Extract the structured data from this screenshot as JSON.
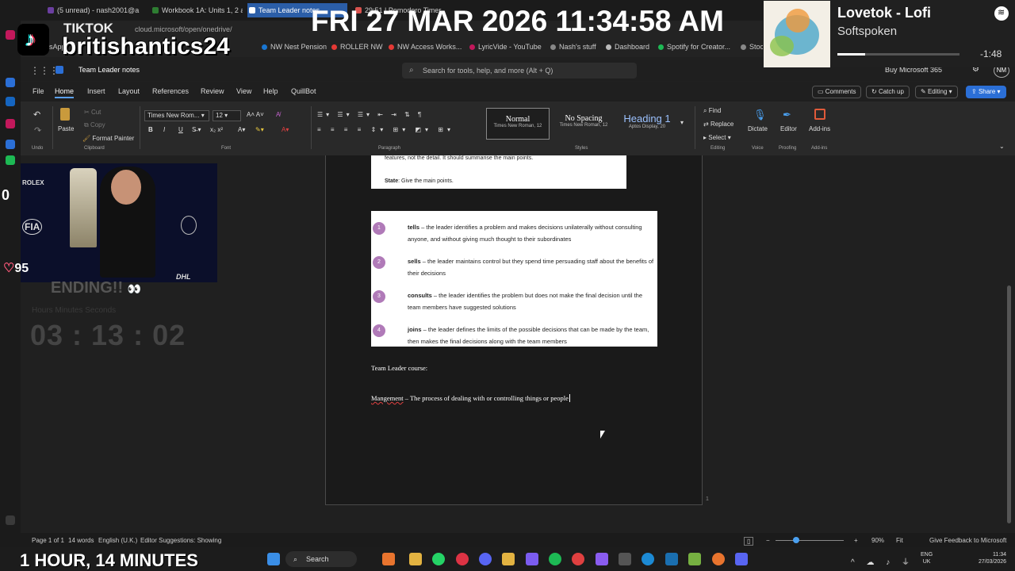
{
  "browser": {
    "tabs": [
      {
        "label": "(5 unread) - nash2001@a",
        "color": "#6b3fa0",
        "active": false
      },
      {
        "label": "Workbook 1A: Units 1, 2 a",
        "color": "#2e7d32",
        "active": false
      },
      {
        "label": "Team Leader notes",
        "color": "#2b5ea8",
        "active": true
      },
      {
        "label": "29:51 | Pomodoro Timer",
        "color": "#d9534f",
        "active": false
      }
    ],
    "url": "cloud.microsoft/open/onedrive/",
    "bookmarks": [
      {
        "label": "WhatsApp",
        "color": "#25d366"
      },
      {
        "label": "NW Nest Pension",
        "color": "#1976d2"
      },
      {
        "label": "ROLLER NW",
        "color": "#e53935"
      },
      {
        "label": "NW Access Works...",
        "color": "#e53935"
      },
      {
        "label": "LyricVide - YouTube",
        "color": "#c2185b"
      },
      {
        "label": "Nash's stuff",
        "color": "#888888"
      },
      {
        "label": "Dashboard",
        "color": "#bbbbbb"
      },
      {
        "label": "Spotify for Creator...",
        "color": "#1db954"
      },
      {
        "label": "Stoc",
        "color": "#888888"
      }
    ]
  },
  "word": {
    "doc_title": "Team Leader notes",
    "search_placeholder": "Search for tools, help, and more (Alt + Q)",
    "buy": "Buy Microsoft 365",
    "avatar": "NM",
    "menus": [
      "File",
      "Home",
      "Insert",
      "Layout",
      "References",
      "Review",
      "View",
      "Help",
      "QuillBot"
    ],
    "active_menu": "Home",
    "right_buttons": {
      "comments": "Comments",
      "catchup": "Catch up",
      "editing": "Editing",
      "share": "Share"
    },
    "ribbon": {
      "undo": "Undo",
      "paste": "Paste",
      "cut": "Cut",
      "copy": "Copy",
      "format_painter": "Format Painter",
      "clipboard": "Clipboard",
      "font_name": "Times New Rom...",
      "font_size": "12",
      "font": "Font",
      "paragraph": "Paragraph",
      "styles_label": "Styles",
      "styles": [
        {
          "name": "Normal",
          "sub": "Times New Roman, 12"
        },
        {
          "name": "No Spacing",
          "sub": "Times New Roman, 12"
        },
        {
          "name": "Heading 1",
          "sub": "Aptos Display, 20"
        }
      ],
      "find": "Find",
      "replace": "Replace",
      "select": "Select",
      "editing": "Editing",
      "dictate": "Dictate",
      "voice": "Voice",
      "editor": "Editor",
      "proofing": "Proofing",
      "addins": "Add-ins",
      "addins_group": "Add-ins"
    },
    "document": {
      "card1_line1": "features, not the detail. It should summarise the main points.",
      "card1_state_label": "State",
      "card1_state_text": ": Give the main points.",
      "list": [
        {
          "num": "1",
          "term": "tells",
          "text": " – the leader identifies a problem and makes decisions unilaterally without consulting anyone, and without giving much thought to their subordinates"
        },
        {
          "num": "2",
          "term": "sells",
          "text": " – the leader maintains control but they spend time persuading staff about the benefits of their decisions"
        },
        {
          "num": "3",
          "term": "consults",
          "text": " – the leader identifies the problem but does not make the final decision until the team members have suggested solutions"
        },
        {
          "num": "4",
          "term": "joins",
          "text": " – the leader defines the limits of the possible decisions that can be made by the team, then makes the final decisions along with the team members"
        }
      ],
      "heading": "Team Leader course:",
      "def_term": "Mangement",
      "def_text": " – The process of dealing with or controlling things or people"
    },
    "status": {
      "page": "Page 1 of 1",
      "words": "14 words",
      "lang": "English (U.K.)",
      "editor": "Editor Suggestions: Showing",
      "zoom": "90%",
      "fit": "Fit",
      "feedback": "Give Feedback to Microsoft",
      "page_corner": "1"
    }
  },
  "overlays": {
    "clock": "FRI 27 MAR 2026 11:34:58 AM",
    "tiktok": "TIKTOK",
    "handle": "britishantics24",
    "song": "Lovetok - Lofi",
    "artist": "Softspoken",
    "remaining": "-1:48",
    "progress": 0.23,
    "ending": "ENDING!!",
    "timer": "03 : 13 : 02",
    "timer_labels": "Hours      Minutes      Seconds",
    "likes": "95",
    "zero": "0",
    "bottom": "1 HOUR, 14 MINUTES",
    "webcam_brand_1": "ROLEX",
    "webcam_brand_2": "FIA",
    "webcam_brand_3": "DHL"
  },
  "taskbar": {
    "search": "Search",
    "lang": "ENG",
    "region": "UK",
    "time": "11:34",
    "date": "27/03/2026"
  }
}
